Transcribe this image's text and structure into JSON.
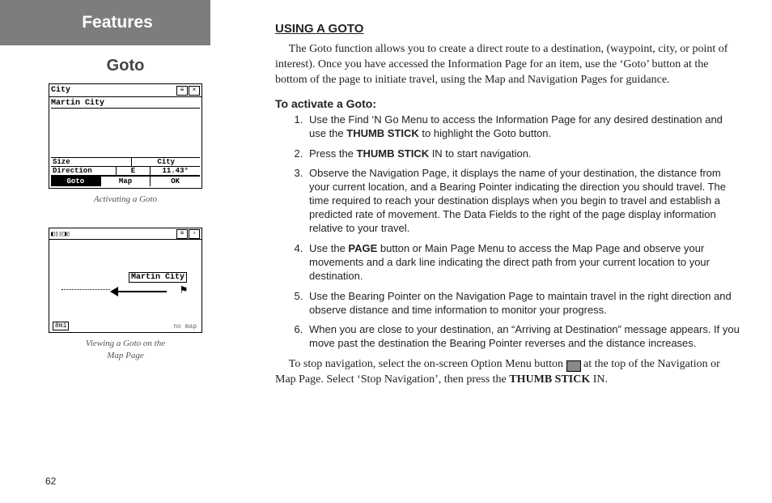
{
  "pageNumber": "62",
  "tabTitle": "Features",
  "sidebarTitle": "Goto",
  "figure1": {
    "caption": "Activating a Goto",
    "headerTitle": "City",
    "itemName": "Martin City",
    "sizeLabel": "Size",
    "cityLabel": "City",
    "directionLabel": "Direction",
    "directionVal": "E",
    "bearingVal": "11.43°",
    "btnGoto": "Goto",
    "btnMap": "Map",
    "btnOk": "OK"
  },
  "figure2": {
    "caption1": "Viewing a Goto on the",
    "caption2": "Map Page",
    "mapLabel": "Martin City",
    "scale": "8mi",
    "noMap": "no map"
  },
  "heading": "USING A GOTO",
  "intro": "The Goto function allows you to create a direct route to a destination, (waypoint, city, or point of interest).  Once you have accessed the Information Page for an item, use the ‘Goto’ button at the bottom of the page to initiate travel, using the Map and Navigation Pages for guidance.",
  "subheading": "To activate a Goto:",
  "steps": {
    "s1a": "Use the Find ‘N Go Menu to access the Information Page for any desired destination and use the ",
    "s1bold": "THUMB STICK",
    "s1b": " to highlight the Goto button.",
    "s2a": "Press the ",
    "s2bold": "THUMB STICK",
    "s2b": " IN to start navigation.",
    "s3": "Observe the Navigation Page, it displays the name of your destination, the distance from your current location, and a Bearing Pointer indicating the direction you should travel.  The time required to reach your destination displays when you begin to travel and establish a predicted rate of movement.  The Data Fields to the right of the page display information relative to your travel.",
    "s4a": "Use the ",
    "s4bold": "PAGE",
    "s4b": " button or Main Page Menu to access the Map Page and observe your movements and a dark line indicating the direct path from your current location to your destination.",
    "s5": "Use the Bearing Pointer on the Navigation Page to maintain travel in the right direction and observe distance and time information to monitor your progress.",
    "s6": "When you are close to your destination, an “Arriving at Destination” message appears.  If you move past the destination the Bearing Pointer reverses and the distance increases."
  },
  "closingA": "To stop navigation, select the on-screen Option Menu button ",
  "closingB": " at the top of the Navigation or Map Page.  Select ‘Stop Navigation’, then press the ",
  "closingBold": "THUMB STICK",
  "closingC": " IN."
}
